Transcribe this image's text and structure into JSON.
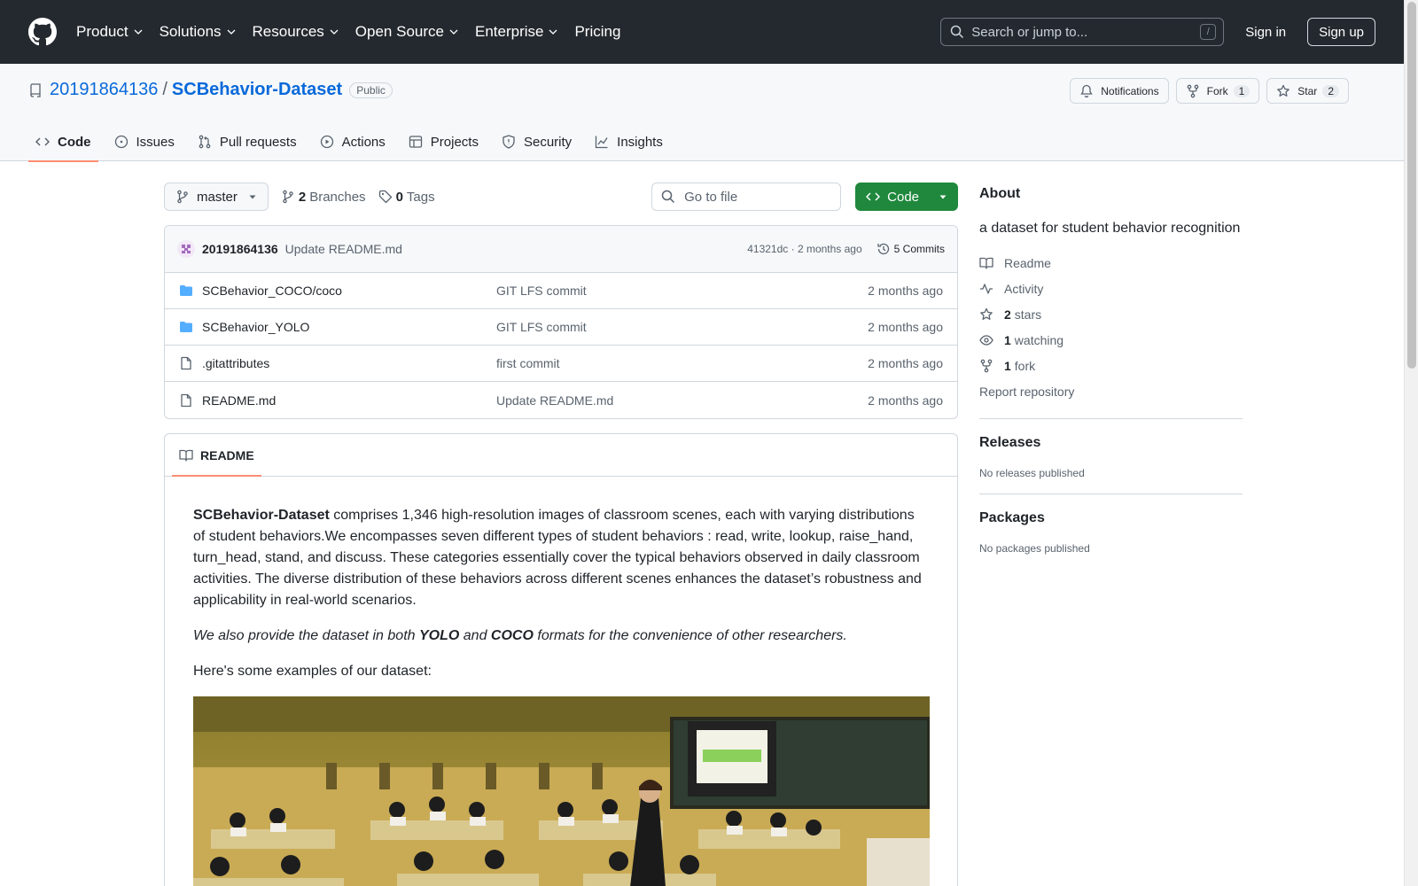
{
  "header": {
    "nav": [
      "Product",
      "Solutions",
      "Resources",
      "Open Source",
      "Enterprise",
      "Pricing"
    ],
    "search_placeholder": "Search or jump to...",
    "search_shortcut": "/",
    "signin": "Sign in",
    "signup": "Sign up"
  },
  "repo": {
    "owner": "20191864136",
    "separator": "/",
    "name": "SCBehavior-Dataset",
    "visibility": "Public",
    "notifications_label": "Notifications",
    "fork_label": "Fork",
    "fork_count": "1",
    "star_label": "Star",
    "star_count": "2"
  },
  "tabs": [
    "Code",
    "Issues",
    "Pull requests",
    "Actions",
    "Projects",
    "Security",
    "Insights"
  ],
  "toolbar": {
    "branch": "master",
    "branches_count": "2",
    "branches_label": "Branches",
    "tags_count": "0",
    "tags_label": "Tags",
    "goto_placeholder": "Go to file",
    "code_button": "Code"
  },
  "commit": {
    "author": "20191864136",
    "message": "Update README.md",
    "hash_time": "41321dc · 2 months ago",
    "commits_label": "5 Commits"
  },
  "files": [
    {
      "type": "folder",
      "name": "SCBehavior_COCO/coco",
      "commit": "GIT LFS commit",
      "age": "2 months ago"
    },
    {
      "type": "folder",
      "name": "SCBehavior_YOLO",
      "commit": "GIT LFS commit",
      "age": "2 months ago"
    },
    {
      "type": "file",
      "name": ".gitattributes",
      "commit": "first commit",
      "age": "2 months ago"
    },
    {
      "type": "file",
      "name": "README.md",
      "commit": "Update README.md",
      "age": "2 months ago"
    }
  ],
  "readme": {
    "tab_label": "README",
    "p1_bold": "SCBehavior-Dataset",
    "p1_rest": " comprises 1,346 high-resolution images of classroom scenes, each with varying distributions of student behaviors.We encompasses seven different types of student behaviors : read, write, lookup, raise_hand, turn_head, stand, and discuss. These categories essentially cover the typical behaviors observed in daily classroom activities. The diverse distribution of these behaviors across different scenes enhances the dataset’s robustness and applicability in real-world scenarios.",
    "p2_a": "We also provide the dataset in both ",
    "p2_yolo": "YOLO",
    "p2_b": " and ",
    "p2_coco": "COCO",
    "p2_c": " formats for the convenience of other researchers.",
    "p3": "Here's some examples of our dataset:"
  },
  "about": {
    "title": "About",
    "description": "a dataset for student behavior recognition",
    "readme": "Readme",
    "activity": "Activity",
    "stars_count": "2",
    "stars_label": "stars",
    "watching_count": "1",
    "watching_label": "watching",
    "forks_count": "1",
    "forks_label": "fork",
    "report": "Report repository"
  },
  "releases": {
    "title": "Releases",
    "empty": "No releases published"
  },
  "packages": {
    "title": "Packages",
    "empty": "No packages published"
  },
  "colors": {
    "header_bg": "#24292f",
    "link": "#0969da",
    "primary_btn": "#1f883d",
    "tab_underline": "#fd8c73"
  }
}
